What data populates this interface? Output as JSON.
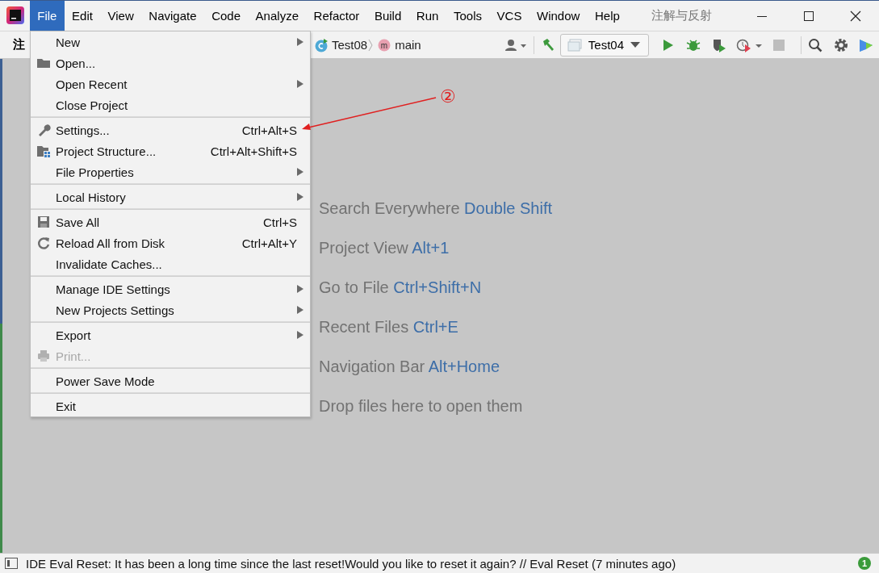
{
  "menubar": [
    {
      "label": "File",
      "selected": true
    },
    {
      "label": "Edit",
      "selected": false
    },
    {
      "label": "View",
      "selected": false
    },
    {
      "label": "Navigate",
      "selected": false
    },
    {
      "label": "Code",
      "selected": false
    },
    {
      "label": "Analyze",
      "selected": false
    },
    {
      "label": "Refactor",
      "selected": false
    },
    {
      "label": "Build",
      "selected": false
    },
    {
      "label": "Run",
      "selected": false
    },
    {
      "label": "Tools",
      "selected": false
    },
    {
      "label": "VCS",
      "selected": false
    },
    {
      "label": "Window",
      "selected": false
    },
    {
      "label": "Help",
      "selected": false
    }
  ],
  "window": {
    "title": "注解与反射"
  },
  "toolbar": {
    "project": "注",
    "breadcrumbs": [
      "Test08",
      "main"
    ],
    "method_badge": "m",
    "run_config": "Test04"
  },
  "file_menu": [
    [
      {
        "label": "New",
        "submenu": true,
        "disabled": false
      },
      {
        "label": "Open...",
        "submenu": false,
        "disabled": false
      },
      {
        "label": "Open Recent",
        "submenu": true,
        "disabled": false
      },
      {
        "label": "Close Project",
        "submenu": false,
        "disabled": false
      }
    ],
    [
      {
        "label": "Settings...",
        "shortcut": "Ctrl+Alt+S",
        "submenu": false,
        "disabled": false
      },
      {
        "label": "Project Structure...",
        "shortcut": "Ctrl+Alt+Shift+S",
        "submenu": false,
        "disabled": false
      },
      {
        "label": "File Properties",
        "submenu": true,
        "disabled": false
      }
    ],
    [
      {
        "label": "Local History",
        "submenu": true,
        "disabled": false
      }
    ],
    [
      {
        "label": "Save All",
        "shortcut": "Ctrl+S",
        "submenu": false,
        "disabled": false
      },
      {
        "label": "Reload All from Disk",
        "shortcut": "Ctrl+Alt+Y",
        "submenu": false,
        "disabled": false
      },
      {
        "label": "Invalidate Caches...",
        "submenu": false,
        "disabled": false
      }
    ],
    [
      {
        "label": "Manage IDE Settings",
        "submenu": true,
        "disabled": false
      },
      {
        "label": "New Projects Settings",
        "submenu": true,
        "disabled": false
      }
    ],
    [
      {
        "label": "Export",
        "submenu": true,
        "disabled": false
      },
      {
        "label": "Print...",
        "submenu": false,
        "disabled": true
      }
    ],
    [
      {
        "label": "Power Save Mode",
        "submenu": false,
        "disabled": false
      }
    ],
    [
      {
        "label": "Exit",
        "submenu": false,
        "disabled": false
      }
    ]
  ],
  "annotation": {
    "marker": "②"
  },
  "welcome_hints": [
    {
      "text": "Search Everywhere",
      "shortcut": "Double Shift"
    },
    {
      "text": "Project View",
      "shortcut": "Alt+1"
    },
    {
      "text": "Go to File",
      "shortcut": "Ctrl+Shift+N"
    },
    {
      "text": "Recent Files",
      "shortcut": "Ctrl+E"
    },
    {
      "text": "Navigation Bar",
      "shortcut": "Alt+Home"
    },
    {
      "text": "Drop files here to open them"
    }
  ],
  "status_bar": {
    "message": "IDE Eval Reset: It has been a long time since the last reset!Would you like to reset it again? // Eval Reset (7 minutes ago)",
    "badge": "1"
  }
}
